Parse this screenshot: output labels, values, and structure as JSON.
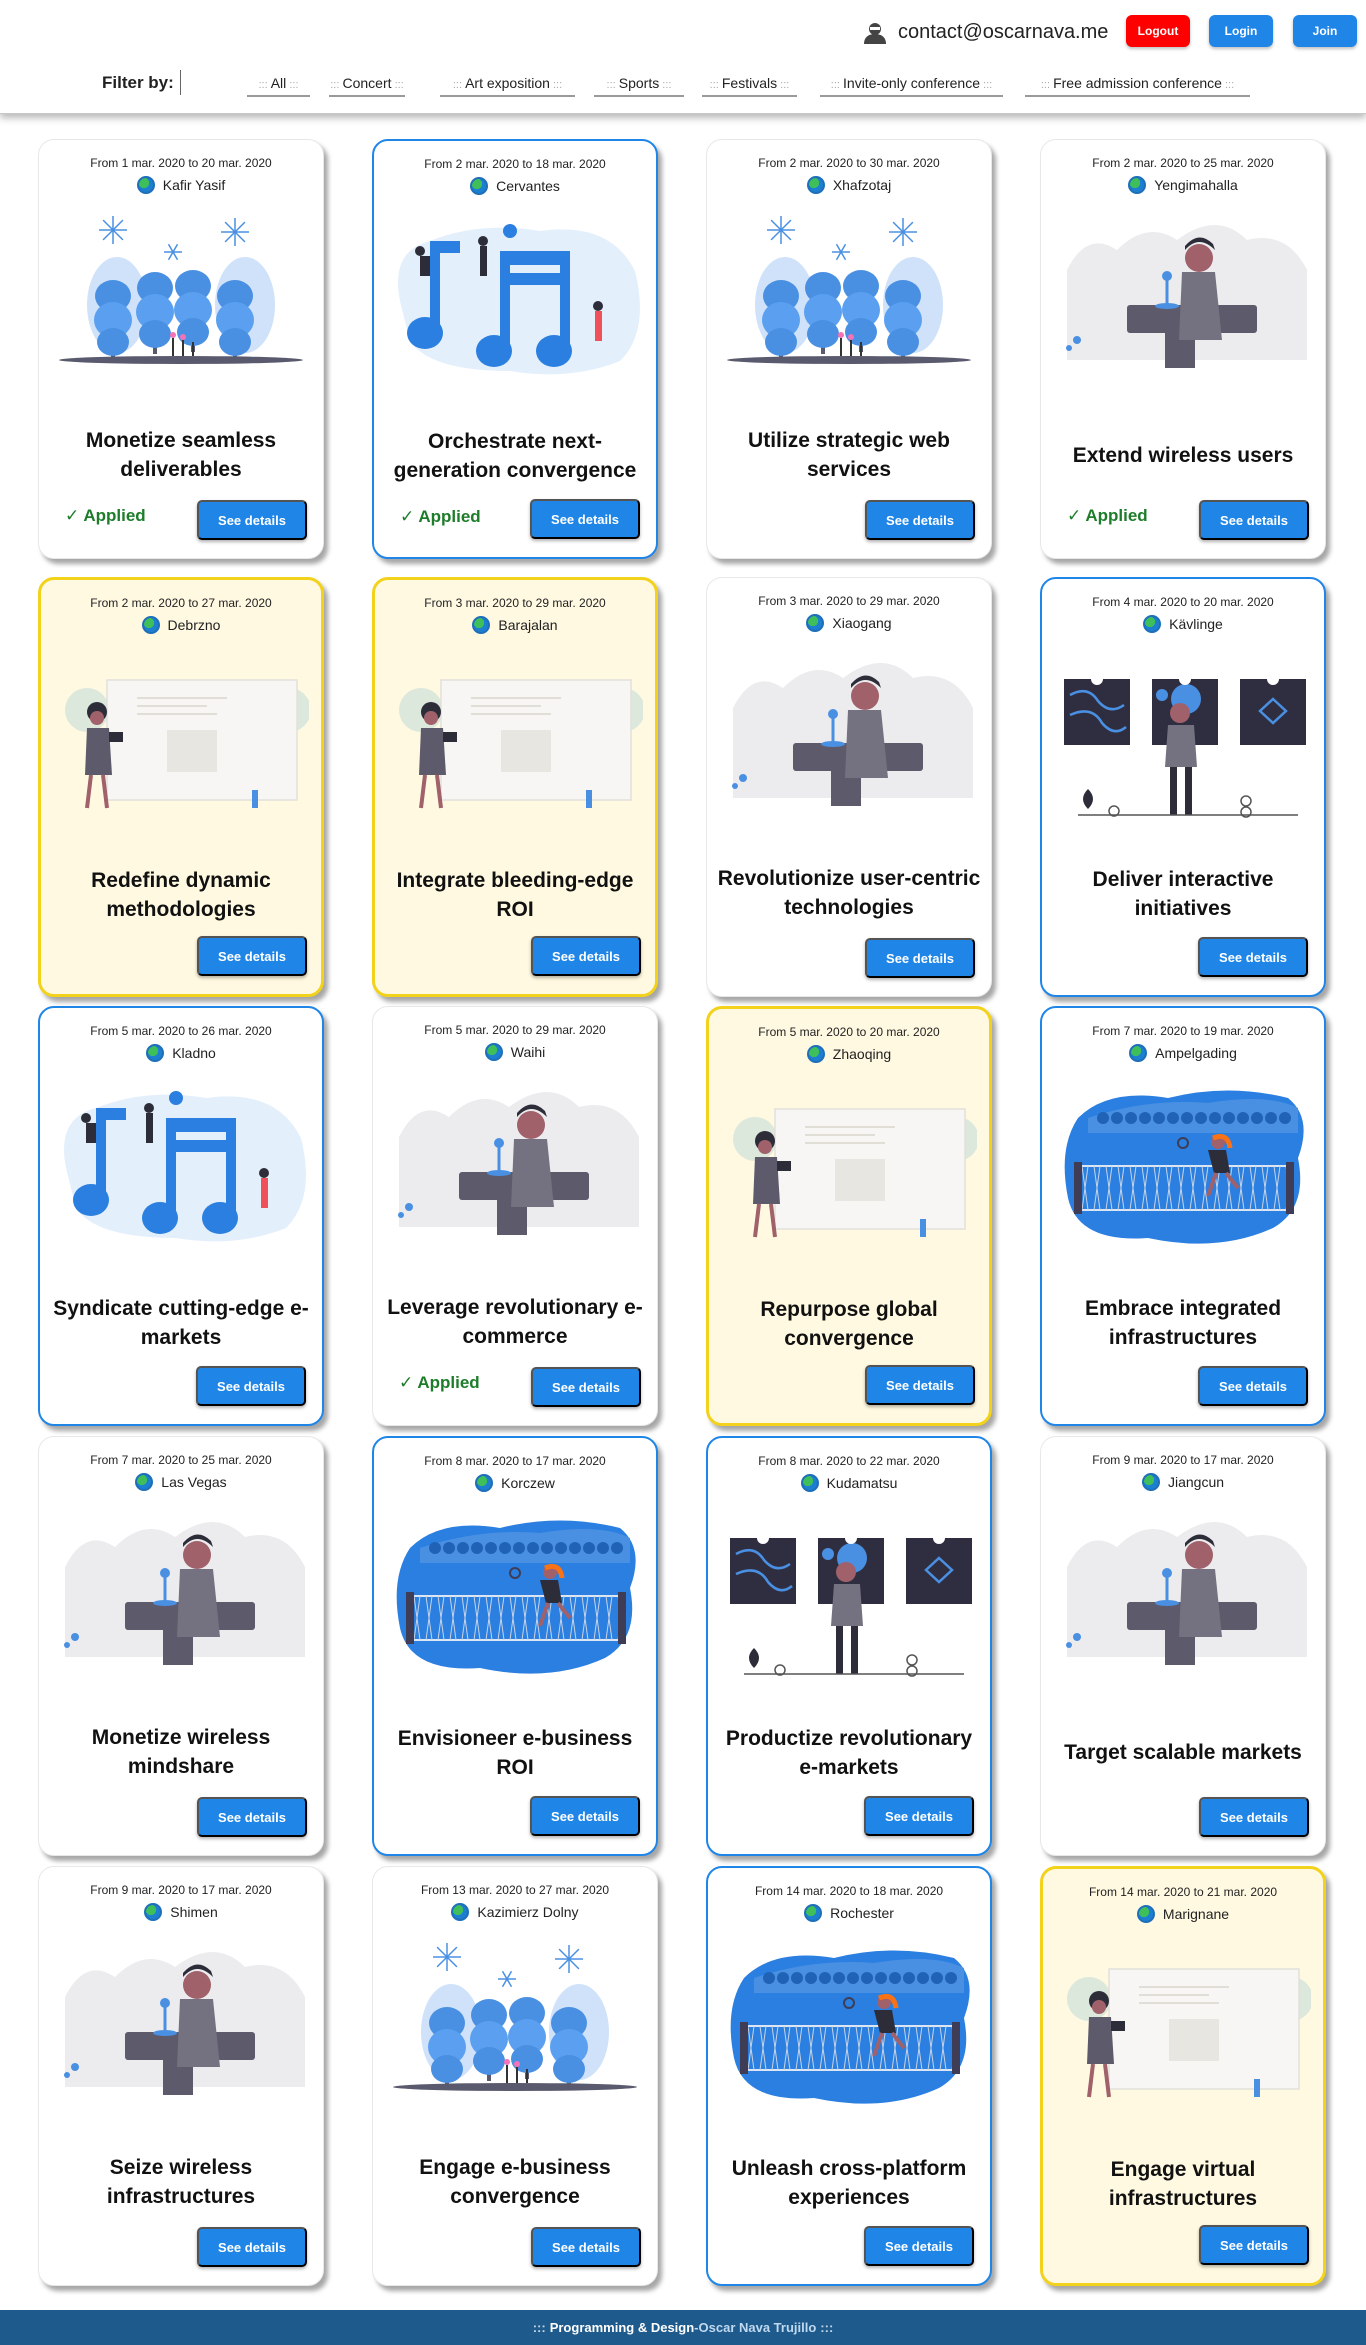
{
  "header": {
    "user_email": "contact@oscarnava.me",
    "buttons": {
      "logout": "Logout",
      "login": "Login",
      "join": "Join"
    },
    "colors": {
      "logout": "#ff0000",
      "primary": "#1f86e8"
    }
  },
  "filter": {
    "label": "Filter by:",
    "decoration": ":::",
    "tabs": [
      "All",
      "Concert",
      "Art exposition",
      "Sports",
      "Festivals",
      "Invite-only conference",
      "Free admission conference"
    ]
  },
  "events": [
    {
      "dates": "From 1 mar. 2020 to 20 mar. 2020",
      "location": "Kafir Yasif",
      "title": "Monetize seamless deliverables",
      "applied": "✓ Applied",
      "style": "plain",
      "illustration": "festival-trees"
    },
    {
      "dates": "From 2 mar. 2020 to 18 mar. 2020",
      "location": "Cervantes",
      "title": "Orchestrate next-generation convergence",
      "applied": "✓ Applied",
      "style": "blue",
      "illustration": "concert-music-notes"
    },
    {
      "dates": "From 2 mar. 2020 to 30 mar. 2020",
      "location": "Xhafzotaj",
      "title": "Utilize strategic web services",
      "style": "plain",
      "illustration": "festival-trees"
    },
    {
      "dates": "From 2 mar. 2020 to 25 mar. 2020",
      "location": "Yengimahalla",
      "title": "Extend wireless users",
      "applied": "✓ Applied",
      "style": "plain",
      "illustration": "conference-speaker"
    },
    {
      "dates": "From 2 mar. 2020 to 27 mar. 2020",
      "location": "Debrzno",
      "title": "Redefine dynamic methodologies",
      "style": "yellow",
      "illustration": "presentation-board"
    },
    {
      "dates": "From 3 mar. 2020 to 29 mar. 2020",
      "location": "Barajalan",
      "title": "Integrate bleeding-edge ROI",
      "style": "yellow",
      "illustration": "presentation-board"
    },
    {
      "dates": "From 3 mar. 2020 to 29 mar. 2020",
      "location": "Xiaogang",
      "title": "Revolutionize user-centric technologies",
      "style": "plain",
      "illustration": "conference-speaker"
    },
    {
      "dates": "From 4 mar. 2020 to 20 mar. 2020",
      "location": "Kävlinge",
      "title": "Deliver interactive initiatives",
      "style": "blue",
      "illustration": "art-exposition"
    },
    {
      "dates": "From 5 mar. 2020 to 26 mar. 2020",
      "location": "Kladno",
      "title": "Syndicate cutting-edge e-markets",
      "style": "blue",
      "illustration": "concert-music-notes"
    },
    {
      "dates": "From 5 mar. 2020 to 29 mar. 2020",
      "location": "Waihi",
      "title": "Leverage revolutionary e-commerce",
      "applied": "✓ Applied",
      "style": "plain",
      "illustration": "conference-speaker"
    },
    {
      "dates": "From 5 mar. 2020 to 20 mar. 2020",
      "location": "Zhaoqing",
      "title": "Repurpose global convergence",
      "style": "yellow",
      "illustration": "presentation-board"
    },
    {
      "dates": "From 7 mar. 2020 to 19 mar. 2020",
      "location": "Ampelgading",
      "title": "Embrace integrated infrastructures",
      "style": "blue",
      "illustration": "sports-tennis"
    },
    {
      "dates": "From 7 mar. 2020 to 25 mar. 2020",
      "location": "Las Vegas",
      "title": "Monetize wireless mindshare",
      "style": "plain",
      "illustration": "conference-speaker"
    },
    {
      "dates": "From 8 mar. 2020 to 17 mar. 2020",
      "location": "Korczew",
      "title": "Envisioneer e-business ROI",
      "style": "blue",
      "illustration": "sports-tennis"
    },
    {
      "dates": "From 8 mar. 2020 to 22 mar. 2020",
      "location": "Kudamatsu",
      "title": "Productize revolutionary e-markets",
      "style": "blue",
      "illustration": "art-exposition"
    },
    {
      "dates": "From 9 mar. 2020 to 17 mar. 2020",
      "location": "Jiangcun",
      "title": "Target scalable markets",
      "style": "plain",
      "illustration": "conference-speaker"
    },
    {
      "dates": "From 9 mar. 2020 to 17 mar. 2020",
      "location": "Shimen",
      "title": "Seize wireless infrastructures",
      "style": "plain",
      "illustration": "conference-speaker"
    },
    {
      "dates": "From 13 mar. 2020 to 27 mar. 2020",
      "location": "Kazimierz Dolny",
      "title": "Engage e-business convergence",
      "style": "plain",
      "illustration": "festival-trees"
    },
    {
      "dates": "From 14 mar. 2020 to 18 mar. 2020",
      "location": "Rochester",
      "title": "Unleash cross-platform experiences",
      "style": "blue",
      "illustration": "sports-tennis"
    },
    {
      "dates": "From 14 mar. 2020 to 21 mar. 2020",
      "location": "Marignane",
      "title": "Engage virtual infrastructures",
      "style": "yellow",
      "illustration": "presentation-board"
    }
  ],
  "card_button_label": "See details",
  "footer": {
    "left": ":::",
    "label": "Programming & Design",
    "separator": " - ",
    "author": "Oscar Nava Trujillo",
    "right": ":::"
  }
}
